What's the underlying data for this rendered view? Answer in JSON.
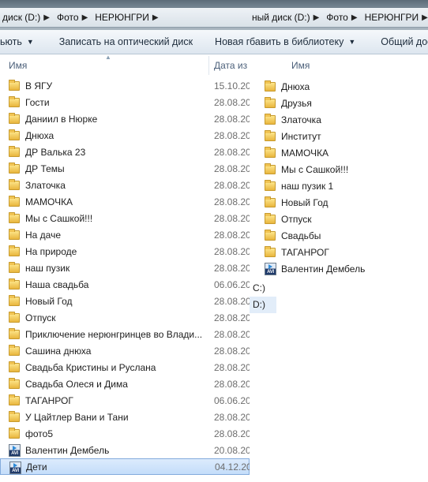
{
  "left_window": {
    "breadcrumb": [
      "диск (D:)",
      "Фото",
      "НЕРЮНГРИ"
    ],
    "toolbar": [
      "ьють",
      "Записать на оптический диск",
      "Новая папка"
    ],
    "columns": {
      "name": "Имя",
      "date": "Дата из"
    },
    "items": [
      {
        "name": "В ЯГУ",
        "date": "15.10.20",
        "type": "folder"
      },
      {
        "name": "Гости",
        "date": "28.08.20",
        "type": "folder"
      },
      {
        "name": "Даниил в Нюрке",
        "date": "28.08.20",
        "type": "folder"
      },
      {
        "name": "Днюха",
        "date": "28.08.20",
        "type": "folder"
      },
      {
        "name": "ДР Валька 23",
        "date": "28.08.20",
        "type": "folder"
      },
      {
        "name": "ДР Темы",
        "date": "28.08.20",
        "type": "folder"
      },
      {
        "name": "Златочка",
        "date": "28.08.20",
        "type": "folder"
      },
      {
        "name": "МАМОЧКА",
        "date": "28.08.20",
        "type": "folder"
      },
      {
        "name": "Мы с Сашкой!!!",
        "date": "28.08.20",
        "type": "folder"
      },
      {
        "name": "На даче",
        "date": "28.08.20",
        "type": "folder"
      },
      {
        "name": "На природе",
        "date": "28.08.20",
        "type": "folder"
      },
      {
        "name": "наш пузик",
        "date": "28.08.20",
        "type": "folder"
      },
      {
        "name": "Наша свадьба",
        "date": "06.06.20",
        "type": "folder"
      },
      {
        "name": "Новый Год",
        "date": "28.08.20",
        "type": "folder"
      },
      {
        "name": "Отпуск",
        "date": "28.08.20",
        "type": "folder"
      },
      {
        "name": "Приключение нерюнгринцев во Влади...",
        "date": "28.08.20",
        "type": "folder"
      },
      {
        "name": "Сашина днюха",
        "date": "28.08.20",
        "type": "folder"
      },
      {
        "name": "Свадьба Кристины и Руслана",
        "date": "28.08.20",
        "type": "folder"
      },
      {
        "name": "Свадьба Олеся и Дима",
        "date": "28.08.20",
        "type": "folder"
      },
      {
        "name": "ТАГАНРОГ",
        "date": "06.06.20",
        "type": "folder"
      },
      {
        "name": "У Цайтлер Вани и Тани",
        "date": "28.08.20",
        "type": "folder"
      },
      {
        "name": "фото5",
        "date": "28.08.20",
        "type": "folder"
      },
      {
        "name": "Валентин Дембель",
        "date": "20.08.20",
        "type": "video"
      },
      {
        "name": "Дети",
        "date": "04.12.20",
        "type": "video",
        "selected": true
      }
    ]
  },
  "right_window": {
    "breadcrumb": [
      "ный диск (D:)",
      "Фото",
      "НЕРЮНГРИ"
    ],
    "toolbar": [
      "бавить в библиотеку",
      "Общий дос"
    ],
    "columns": {
      "name": "Имя"
    },
    "items": [
      {
        "name": "Днюха",
        "type": "folder"
      },
      {
        "name": "Друзья",
        "type": "folder"
      },
      {
        "name": "Златочка",
        "type": "folder"
      },
      {
        "name": "Институт",
        "type": "folder"
      },
      {
        "name": "МАМОЧКА",
        "type": "folder"
      },
      {
        "name": "Мы с Сашкой!!!",
        "type": "folder"
      },
      {
        "name": "наш пузик 1",
        "type": "folder"
      },
      {
        "name": "Новый Год",
        "type": "folder"
      },
      {
        "name": "Отпуск",
        "type": "folder"
      },
      {
        "name": "Свадьбы",
        "type": "folder"
      },
      {
        "name": "ТАГАНРОГ",
        "type": "folder"
      },
      {
        "name": "Валентин Дембель",
        "type": "video"
      }
    ],
    "drives": [
      "С:)",
      "D:)"
    ],
    "icon_label": "AVI"
  }
}
